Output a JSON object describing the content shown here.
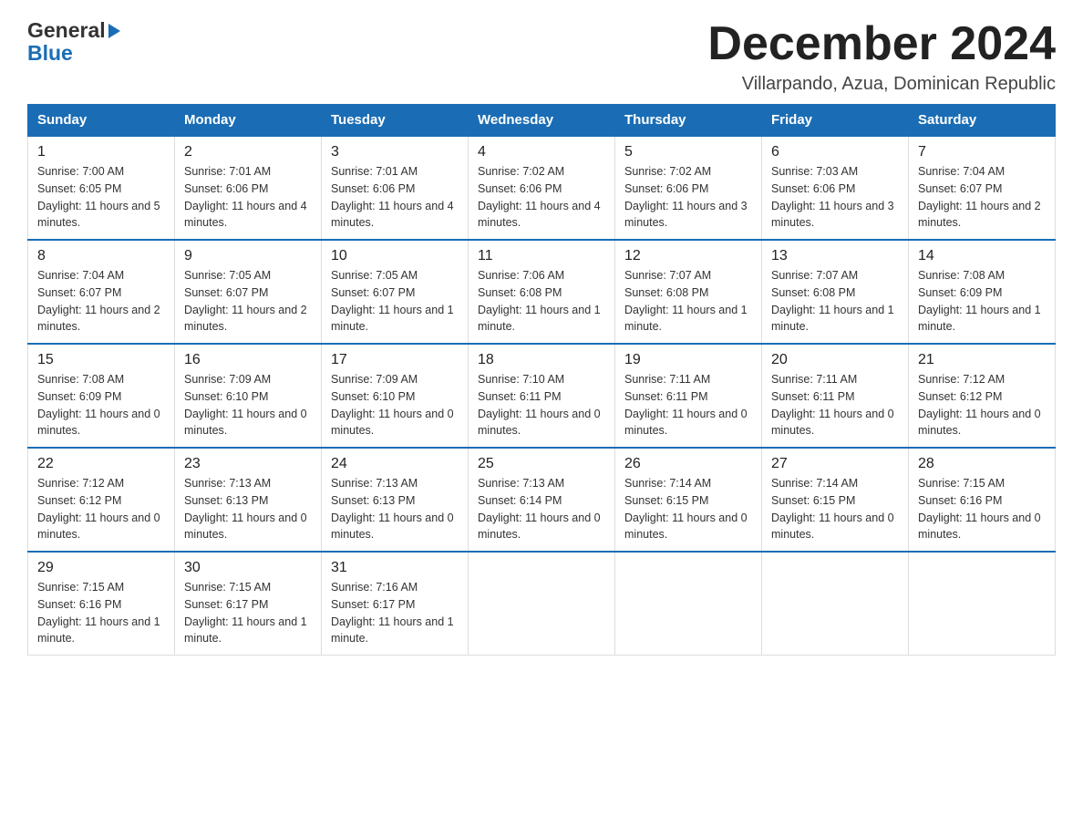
{
  "logo": {
    "general": "General",
    "blue": "Blue"
  },
  "header": {
    "month_year": "December 2024",
    "location": "Villarpando, Azua, Dominican Republic"
  },
  "weekdays": [
    "Sunday",
    "Monday",
    "Tuesday",
    "Wednesday",
    "Thursday",
    "Friday",
    "Saturday"
  ],
  "weeks": [
    [
      {
        "day": "1",
        "sunrise": "7:00 AM",
        "sunset": "6:05 PM",
        "daylight": "11 hours and 5 minutes."
      },
      {
        "day": "2",
        "sunrise": "7:01 AM",
        "sunset": "6:06 PM",
        "daylight": "11 hours and 4 minutes."
      },
      {
        "day": "3",
        "sunrise": "7:01 AM",
        "sunset": "6:06 PM",
        "daylight": "11 hours and 4 minutes."
      },
      {
        "day": "4",
        "sunrise": "7:02 AM",
        "sunset": "6:06 PM",
        "daylight": "11 hours and 4 minutes."
      },
      {
        "day": "5",
        "sunrise": "7:02 AM",
        "sunset": "6:06 PM",
        "daylight": "11 hours and 3 minutes."
      },
      {
        "day": "6",
        "sunrise": "7:03 AM",
        "sunset": "6:06 PM",
        "daylight": "11 hours and 3 minutes."
      },
      {
        "day": "7",
        "sunrise": "7:04 AM",
        "sunset": "6:07 PM",
        "daylight": "11 hours and 2 minutes."
      }
    ],
    [
      {
        "day": "8",
        "sunrise": "7:04 AM",
        "sunset": "6:07 PM",
        "daylight": "11 hours and 2 minutes."
      },
      {
        "day": "9",
        "sunrise": "7:05 AM",
        "sunset": "6:07 PM",
        "daylight": "11 hours and 2 minutes."
      },
      {
        "day": "10",
        "sunrise": "7:05 AM",
        "sunset": "6:07 PM",
        "daylight": "11 hours and 1 minute."
      },
      {
        "day": "11",
        "sunrise": "7:06 AM",
        "sunset": "6:08 PM",
        "daylight": "11 hours and 1 minute."
      },
      {
        "day": "12",
        "sunrise": "7:07 AM",
        "sunset": "6:08 PM",
        "daylight": "11 hours and 1 minute."
      },
      {
        "day": "13",
        "sunrise": "7:07 AM",
        "sunset": "6:08 PM",
        "daylight": "11 hours and 1 minute."
      },
      {
        "day": "14",
        "sunrise": "7:08 AM",
        "sunset": "6:09 PM",
        "daylight": "11 hours and 1 minute."
      }
    ],
    [
      {
        "day": "15",
        "sunrise": "7:08 AM",
        "sunset": "6:09 PM",
        "daylight": "11 hours and 0 minutes."
      },
      {
        "day": "16",
        "sunrise": "7:09 AM",
        "sunset": "6:10 PM",
        "daylight": "11 hours and 0 minutes."
      },
      {
        "day": "17",
        "sunrise": "7:09 AM",
        "sunset": "6:10 PM",
        "daylight": "11 hours and 0 minutes."
      },
      {
        "day": "18",
        "sunrise": "7:10 AM",
        "sunset": "6:11 PM",
        "daylight": "11 hours and 0 minutes."
      },
      {
        "day": "19",
        "sunrise": "7:11 AM",
        "sunset": "6:11 PM",
        "daylight": "11 hours and 0 minutes."
      },
      {
        "day": "20",
        "sunrise": "7:11 AM",
        "sunset": "6:11 PM",
        "daylight": "11 hours and 0 minutes."
      },
      {
        "day": "21",
        "sunrise": "7:12 AM",
        "sunset": "6:12 PM",
        "daylight": "11 hours and 0 minutes."
      }
    ],
    [
      {
        "day": "22",
        "sunrise": "7:12 AM",
        "sunset": "6:12 PM",
        "daylight": "11 hours and 0 minutes."
      },
      {
        "day": "23",
        "sunrise": "7:13 AM",
        "sunset": "6:13 PM",
        "daylight": "11 hours and 0 minutes."
      },
      {
        "day": "24",
        "sunrise": "7:13 AM",
        "sunset": "6:13 PM",
        "daylight": "11 hours and 0 minutes."
      },
      {
        "day": "25",
        "sunrise": "7:13 AM",
        "sunset": "6:14 PM",
        "daylight": "11 hours and 0 minutes."
      },
      {
        "day": "26",
        "sunrise": "7:14 AM",
        "sunset": "6:15 PM",
        "daylight": "11 hours and 0 minutes."
      },
      {
        "day": "27",
        "sunrise": "7:14 AM",
        "sunset": "6:15 PM",
        "daylight": "11 hours and 0 minutes."
      },
      {
        "day": "28",
        "sunrise": "7:15 AM",
        "sunset": "6:16 PM",
        "daylight": "11 hours and 0 minutes."
      }
    ],
    [
      {
        "day": "29",
        "sunrise": "7:15 AM",
        "sunset": "6:16 PM",
        "daylight": "11 hours and 1 minute."
      },
      {
        "day": "30",
        "sunrise": "7:15 AM",
        "sunset": "6:17 PM",
        "daylight": "11 hours and 1 minute."
      },
      {
        "day": "31",
        "sunrise": "7:16 AM",
        "sunset": "6:17 PM",
        "daylight": "11 hours and 1 minute."
      },
      null,
      null,
      null,
      null
    ]
  ],
  "labels": {
    "sunrise": "Sunrise:",
    "sunset": "Sunset:",
    "daylight": "Daylight:"
  }
}
